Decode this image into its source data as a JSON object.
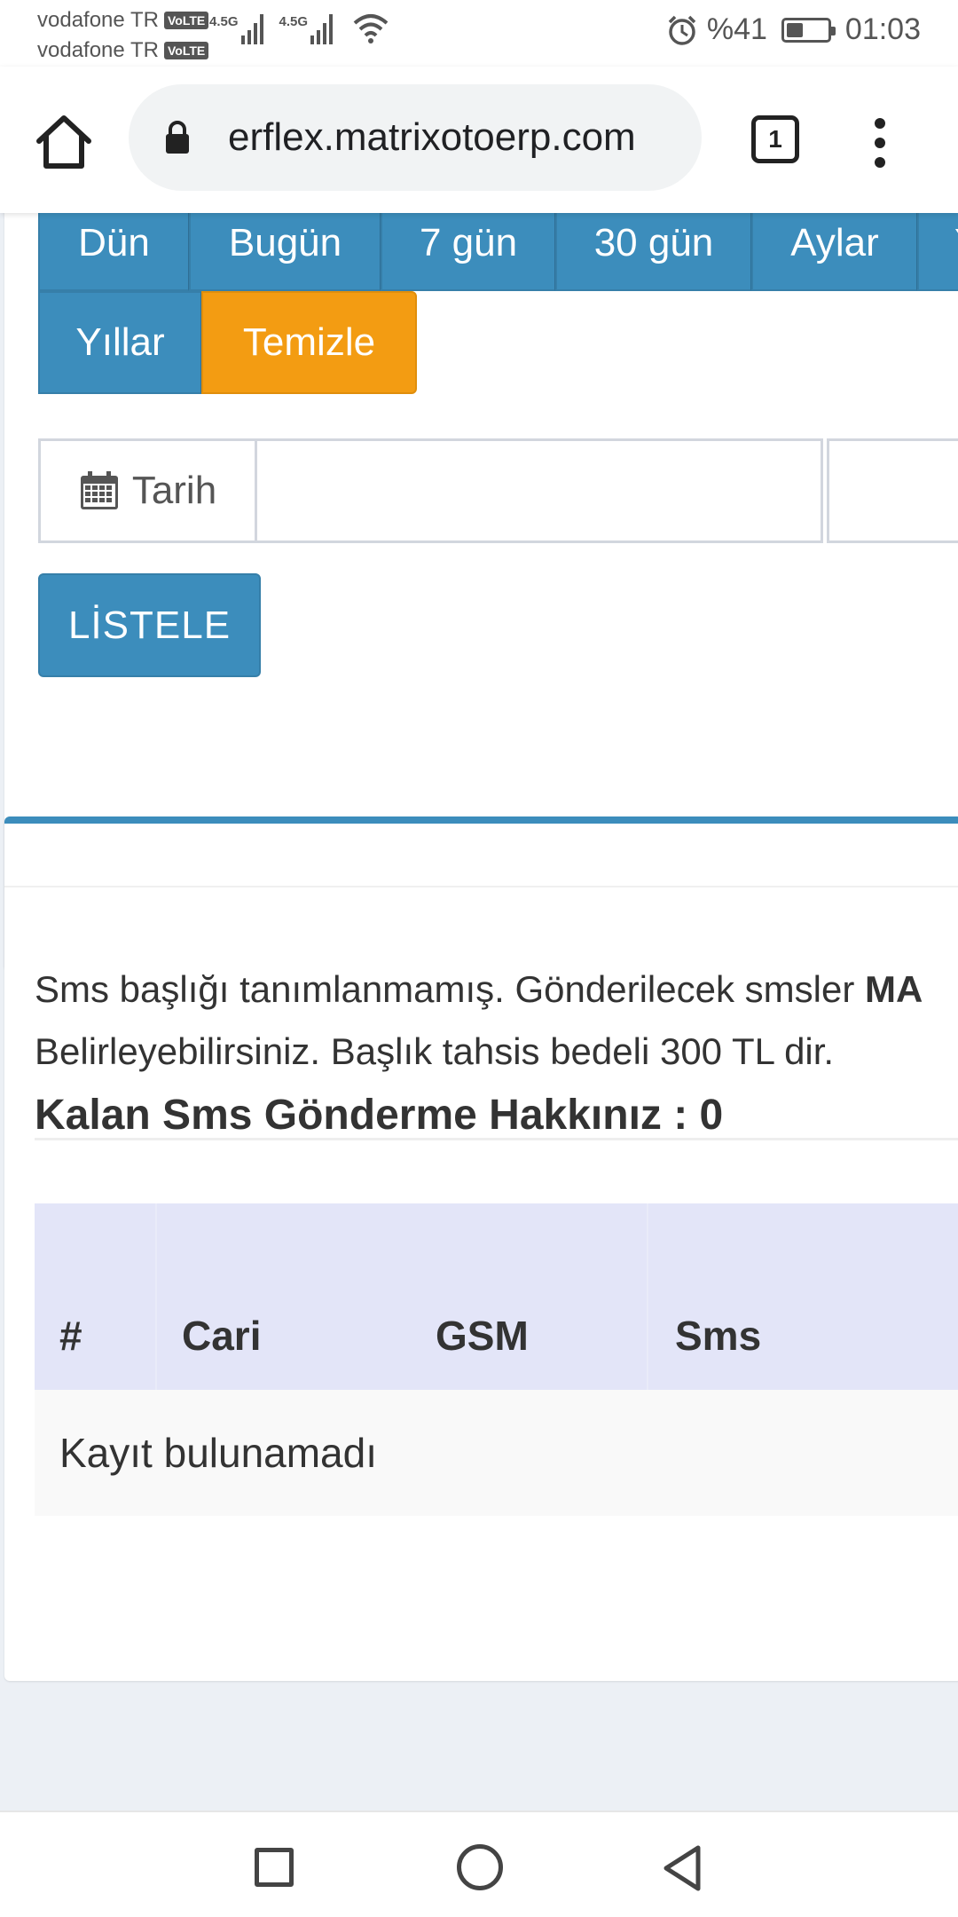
{
  "status_bar": {
    "carrier1": "vodafone TR",
    "carrier2": "vodafone TR",
    "volte": "VoLTE",
    "net1": "4.5G",
    "net2": "4.5G",
    "battery": "%41",
    "battery_level": 0.41,
    "time": "01:03"
  },
  "browser": {
    "url": "​erflex.matrixotoerp.com",
    "tab_count": "1"
  },
  "range_buttons_row1": [
    "Dün",
    "Bugün",
    "7 gün",
    "30 gün",
    "Aylar",
    "Y"
  ],
  "range_buttons_row2": [
    "Yıllar"
  ],
  "clear_button": "Temizle",
  "date_label": "Tarih",
  "list_button": "LİSTELE",
  "info": {
    "line1_prefix": "Sms başlığı tanımlanmamış. Gönderilecek smsler ",
    "line1_bold": "MA",
    "line2": "Belirleyebilirsiniz. Başlık tahsis bedeli 300 TL dir.",
    "remaining": "Kalan Sms Gönderme Hakkınız : 0"
  },
  "table": {
    "columns": [
      "#",
      "Cari",
      "GSM",
      "Sms"
    ],
    "empty_text": "Kayıt bulunamadı"
  },
  "colors": {
    "primary": "#3c8dbc",
    "warning": "#f39c12",
    "table_head": "#e3e5f8"
  }
}
